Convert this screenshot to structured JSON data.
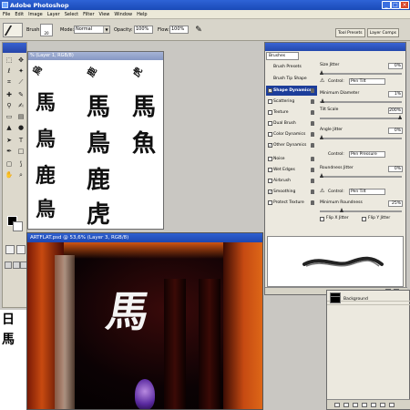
{
  "window": {
    "title": "Adobe Photoshop",
    "minimize": "_",
    "maximize": "□",
    "close": "×"
  },
  "menu": [
    "File",
    "Edit",
    "Image",
    "Layer",
    "Select",
    "Filter",
    "View",
    "Window",
    "Help"
  ],
  "options": {
    "brush_label": "Brush:",
    "brush_size": "20",
    "mode_label": "Mode:",
    "mode_value": "Normal",
    "opacity_label": "Opacity:",
    "opacity_value": "100%",
    "flow_label": "Flow:",
    "flow_value": "100%",
    "arrow": "▼",
    "airbrush_icon": "airbrush-icon"
  },
  "palette_tabs": [
    "Tool Presets",
    "Layer Comps"
  ],
  "doc1": {
    "title": "% (Layer 1, RGB/8)",
    "chars": [
      "馬",
      "鳥",
      "烏",
      "鹿",
      "虎",
      "魚",
      "馬",
      "鳥",
      "魚"
    ]
  },
  "doc2": {
    "title": "ARTFLAT.psd @ 53,6% (Layer 3, RGB/8)",
    "art_char": "馬"
  },
  "brushes": {
    "title": "Brushes",
    "tab_label": "Brushes",
    "items": [
      {
        "label": "Brush Presets",
        "checkbox": false,
        "checked": false,
        "locked": false
      },
      {
        "label": "Brush Tip Shape",
        "checkbox": false,
        "checked": false,
        "locked": false
      },
      {
        "label": "Shape Dynamics",
        "checkbox": true,
        "checked": true,
        "locked": true,
        "selected": true
      },
      {
        "label": "Scattering",
        "checkbox": true,
        "checked": false,
        "locked": true
      },
      {
        "label": "Texture",
        "checkbox": true,
        "checked": false,
        "locked": true
      },
      {
        "label": "Dual Brush",
        "checkbox": true,
        "checked": false,
        "locked": true
      },
      {
        "label": "Color Dynamics",
        "checkbox": true,
        "checked": false,
        "locked": true
      },
      {
        "label": "Other Dynamics",
        "checkbox": true,
        "checked": true,
        "locked": true
      },
      {
        "label": "Noise",
        "checkbox": true,
        "checked": false,
        "locked": true
      },
      {
        "label": "Wet Edges",
        "checkbox": true,
        "checked": false,
        "locked": true
      },
      {
        "label": "Airbrush",
        "checkbox": true,
        "checked": false,
        "locked": true
      },
      {
        "label": "Smoothing",
        "checkbox": true,
        "checked": true,
        "locked": true
      },
      {
        "label": "Protect Texture",
        "checkbox": true,
        "checked": false,
        "locked": true
      }
    ],
    "size_jitter": {
      "label": "Size Jitter",
      "value": "0%"
    },
    "control1": {
      "label": "Control:",
      "value": "Pen Tilt"
    },
    "min_diameter": {
      "label": "Minimum Diameter",
      "value": "1%"
    },
    "tilt_scale": {
      "label": "Tilt Scale",
      "value": "200%"
    },
    "angle_jitter": {
      "label": "Angle Jitter",
      "value": "0%"
    },
    "control2": {
      "label": "Control:",
      "value": "Pen Pressure"
    },
    "roundness_jitter": {
      "label": "Roundness Jitter",
      "value": "0%"
    },
    "control3": {
      "label": "Control:",
      "value": "Pen Tilt"
    },
    "min_roundness": {
      "label": "Minimum Roundness",
      "value": "25%"
    },
    "flip_x": "Flip X Jitter",
    "flip_y": "Flip Y Jitter",
    "warning_icon": "⚠",
    "check_mark": "✓"
  },
  "layers": {
    "rows": [
      {
        "name": ""
      },
      {
        "name": "Background"
      }
    ]
  },
  "left_edge_chars": [
    "日",
    "馬"
  ],
  "icons": {
    "toolbox": [
      "move-icon",
      "marquee-icon",
      "lasso-icon",
      "magic-wand-icon",
      "crop-icon",
      "slice-icon",
      "healing-icon",
      "brush-icon",
      "stamp-icon",
      "history-brush-icon",
      "eraser-icon",
      "gradient-icon",
      "blur-icon",
      "dodge-icon",
      "path-select-icon",
      "type-icon",
      "pen-icon",
      "shape-icon",
      "notes-icon",
      "eyedropper-icon",
      "hand-icon",
      "zoom-icon"
    ]
  },
  "colors": {
    "titlebar": "#1a4ab8",
    "selected_item": "#1c3d9a",
    "foreground": "#000000",
    "background": "#ffffff"
  }
}
